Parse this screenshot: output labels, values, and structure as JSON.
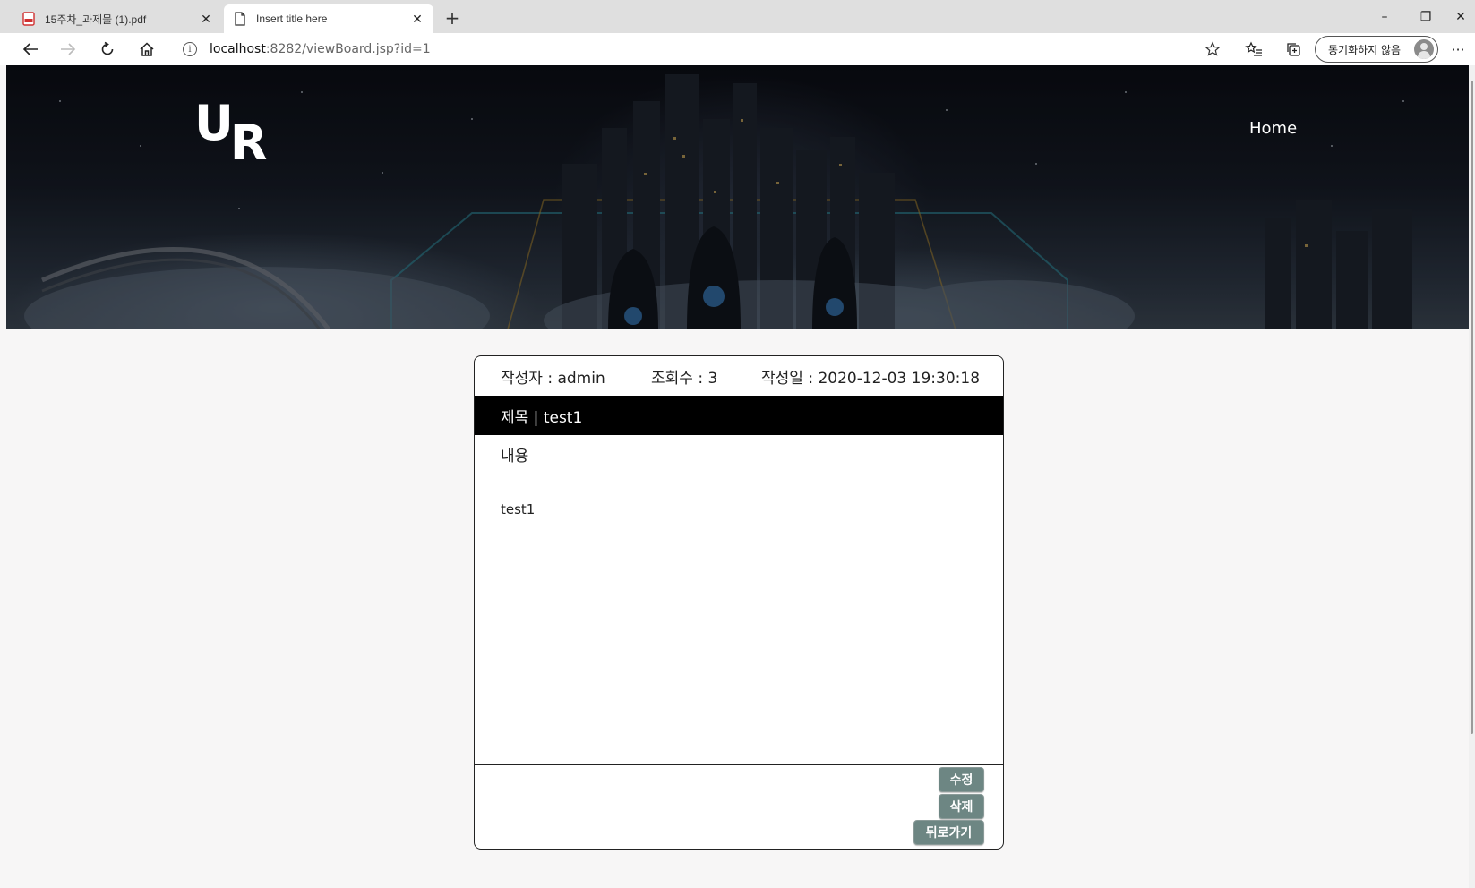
{
  "browser": {
    "tabs": [
      {
        "title": "15주차_과제물 (1).pdf",
        "icon": "pdf-icon",
        "active": false
      },
      {
        "title": "Insert title here",
        "icon": "document-icon",
        "active": true
      }
    ],
    "new_tab": "+",
    "window_controls": {
      "minimize": "–",
      "restore": "❐",
      "close": "✕"
    },
    "url_host": "localhost",
    "url_rest": ":8282/viewBoard.jsp?id=1",
    "sync_label": "동기화하지 않음",
    "more": "···"
  },
  "header": {
    "logo_u": "U",
    "logo_r": "R",
    "nav_home": "Home"
  },
  "board": {
    "author": "작성자 : admin",
    "views": "조회수 : 3",
    "date": "작성일 : 2020-12-03 19:30:18",
    "title": "제목 | test1",
    "content_label": "내용",
    "content": "test1",
    "edit_label": "수정",
    "delete_label": "삭제",
    "back_label": "뒤로가기"
  },
  "colors": {
    "button": "#6d8683",
    "title_bar": "#000000",
    "page_bg": "#f7f6f6"
  }
}
